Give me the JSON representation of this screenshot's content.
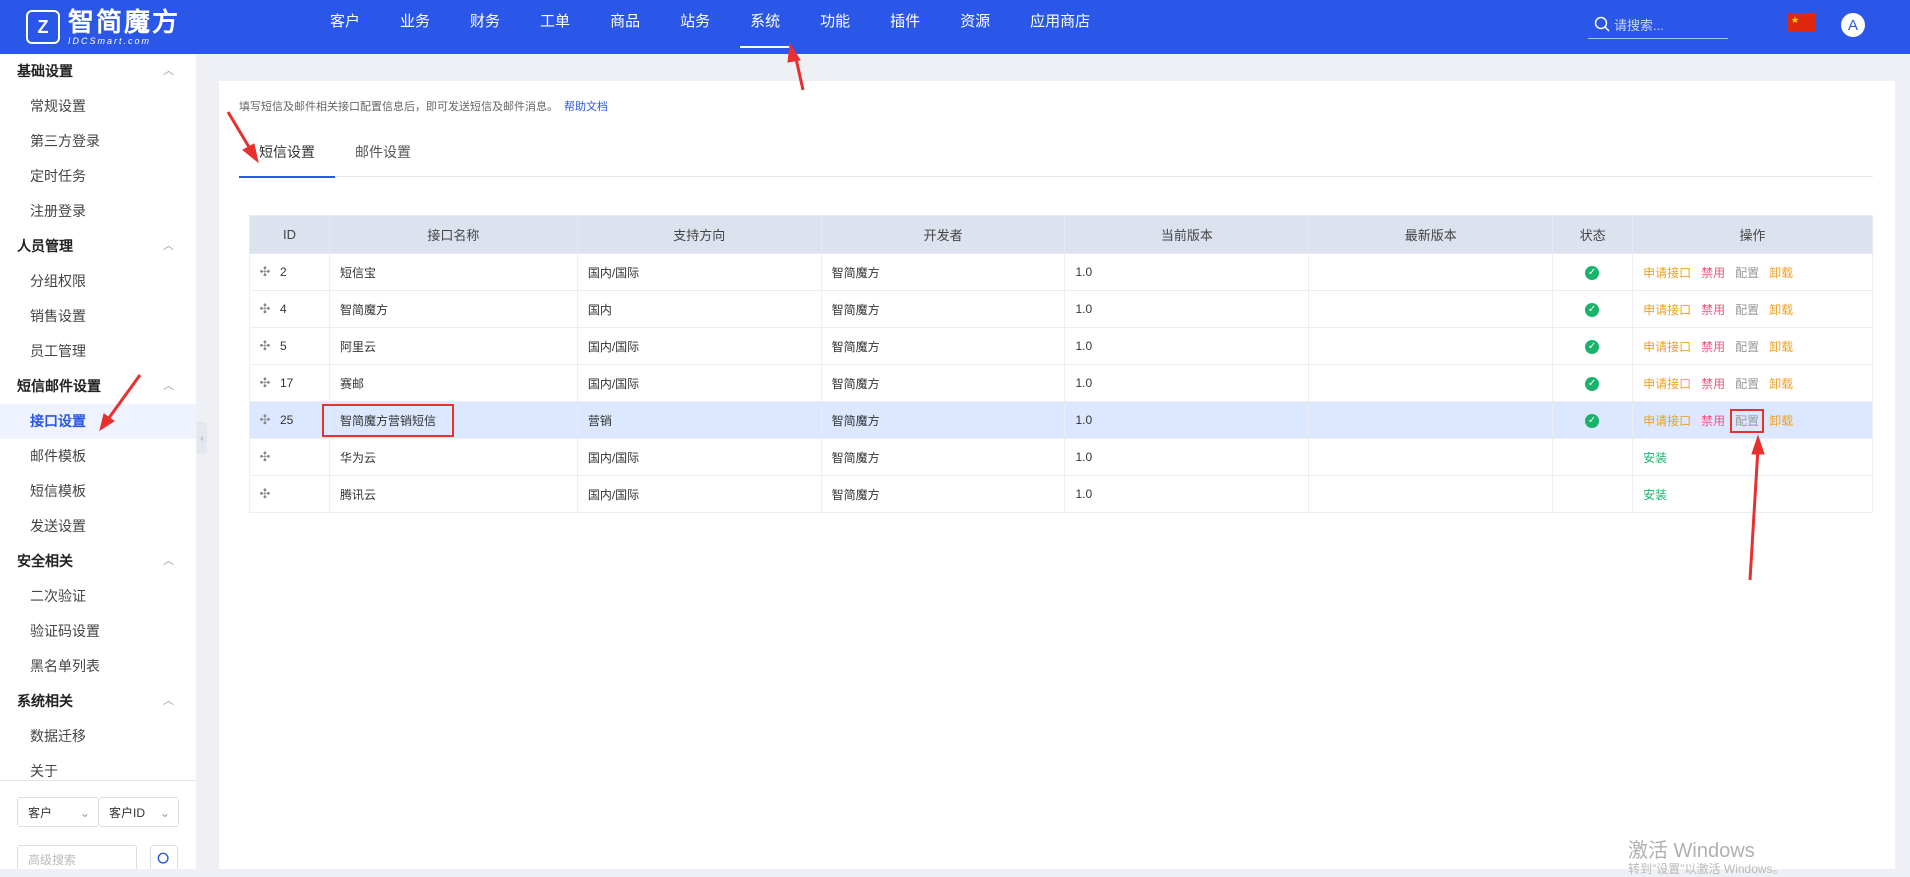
{
  "header": {
    "logo_main": "智简魔方",
    "logo_sub": "IDCSmart.com",
    "nav": [
      "客户",
      "业务",
      "财务",
      "工单",
      "商品",
      "站务",
      "系统",
      "功能",
      "插件",
      "资源",
      "应用商店"
    ],
    "active_nav": "系统",
    "search_placeholder": "请搜索...",
    "avatar_letter": "A"
  },
  "sidebar": {
    "groups": [
      {
        "title": "基础设置",
        "items": [
          "常规设置",
          "第三方登录",
          "定时任务",
          "注册登录"
        ]
      },
      {
        "title": "人员管理",
        "items": [
          "分组权限",
          "销售设置",
          "员工管理"
        ]
      },
      {
        "title": "短信邮件设置",
        "items": [
          "接口设置",
          "邮件模板",
          "短信模板",
          "发送设置"
        ]
      },
      {
        "title": "安全相关",
        "items": [
          "二次验证",
          "验证码设置",
          "黑名单列表"
        ]
      },
      {
        "title": "系统相关",
        "items": [
          "数据迁移",
          "关于"
        ]
      }
    ],
    "active_item": "接口设置",
    "bottom": {
      "select1": "客户",
      "select2": "客户ID",
      "advanced_placeholder": "高级搜索"
    }
  },
  "content": {
    "tip": "填写短信及邮件相关接口配置信息后，即可发送短信及邮件消息。",
    "help_link": "帮助文档",
    "tabs": [
      "短信设置",
      "邮件设置"
    ],
    "active_tab": "短信设置",
    "table": {
      "headers": [
        "ID",
        "接口名称",
        "支持方向",
        "开发者",
        "当前版本",
        "最新版本",
        "状态",
        "操作"
      ],
      "rows": [
        {
          "id": "2",
          "name": "短信宝",
          "direction": "国内/国际",
          "developer": "智简魔方",
          "version": "1.0",
          "latest": "",
          "status": "enabled",
          "actions": [
            "申请接口",
            "禁用",
            "配置",
            "卸载"
          ],
          "highlight": false
        },
        {
          "id": "4",
          "name": "智简魔方",
          "direction": "国内",
          "developer": "智简魔方",
          "version": "1.0",
          "latest": "",
          "status": "enabled",
          "actions": [
            "申请接口",
            "禁用",
            "配置",
            "卸载"
          ],
          "highlight": false
        },
        {
          "id": "5",
          "name": "阿里云",
          "direction": "国内/国际",
          "developer": "智简魔方",
          "version": "1.0",
          "latest": "",
          "status": "enabled",
          "actions": [
            "申请接口",
            "禁用",
            "配置",
            "卸载"
          ],
          "highlight": false
        },
        {
          "id": "17",
          "name": "赛邮",
          "direction": "国内/国际",
          "developer": "智简魔方",
          "version": "1.0",
          "latest": "",
          "status": "enabled",
          "actions": [
            "申请接口",
            "禁用",
            "配置",
            "卸载"
          ],
          "highlight": false
        },
        {
          "id": "25",
          "name": "智简魔方营销短信",
          "direction": "营销",
          "developer": "智简魔方",
          "version": "1.0",
          "latest": "",
          "status": "enabled",
          "actions": [
            "申请接口",
            "禁用",
            "配置",
            "卸载"
          ],
          "highlight": true
        },
        {
          "id": "",
          "name": "华为云",
          "direction": "国内/国际",
          "developer": "智简魔方",
          "version": "1.0",
          "latest": "",
          "status": "",
          "actions": [
            "安装"
          ],
          "highlight": false
        },
        {
          "id": "",
          "name": "腾讯云",
          "direction": "国内/国际",
          "developer": "智简魔方",
          "version": "1.0",
          "latest": "",
          "status": "",
          "actions": [
            "安装"
          ],
          "highlight": false
        }
      ]
    }
  },
  "watermark": {
    "line1": "激活 Windows",
    "line2": "转到\"设置\"以激活 Windows。"
  },
  "colors": {
    "brand": "#2b57e8",
    "apply": "#f0a020",
    "disable": "#f0567a",
    "install": "#19b36b",
    "annotation": "#e8302f"
  }
}
